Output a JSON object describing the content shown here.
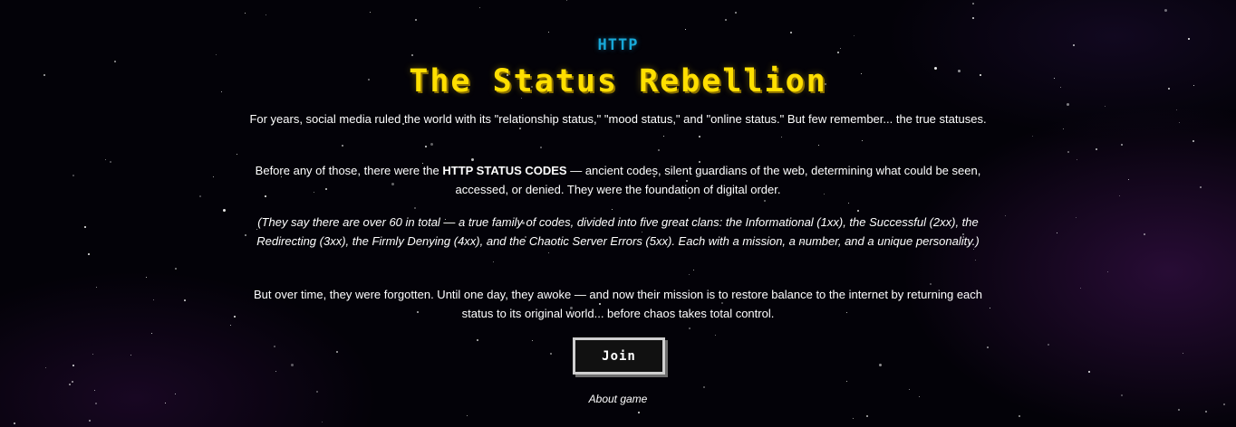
{
  "header": {
    "kicker": "HTTP",
    "title": "The Status Rebellion"
  },
  "story": {
    "p1": "For years, social media ruled the world with its \"relationship status,\" \"mood status,\" and \"online status.\" But few remember... the true statuses.",
    "p2_before": "Before any of those, there were the ",
    "p2_strong": "HTTP STATUS CODES",
    "p2_after": " — ancient codes, silent guardians of the web, determining what could be seen, accessed, or denied. They were the foundation of digital order.",
    "p3": "(They say there are over 60 in total — a true family of codes, divided into five great clans: the Informational (1xx), the Successful (2xx), the Redirecting (3xx), the Firmly Denying (4xx), and the Chaotic Server Errors (5xx). Each with a mission, a number, and a unique personality.)",
    "p4": "But over time, they were forgotten. Until one day, they awoke — and now their mission is to restore balance to the internet by returning each status to its original world... before chaos takes total control."
  },
  "actions": {
    "join_label": "Join",
    "about_label": "About game"
  },
  "colors": {
    "kicker": "#18a8d8",
    "title": "#ffdf00",
    "background": "#030208",
    "button_border": "#cfcfcf"
  }
}
